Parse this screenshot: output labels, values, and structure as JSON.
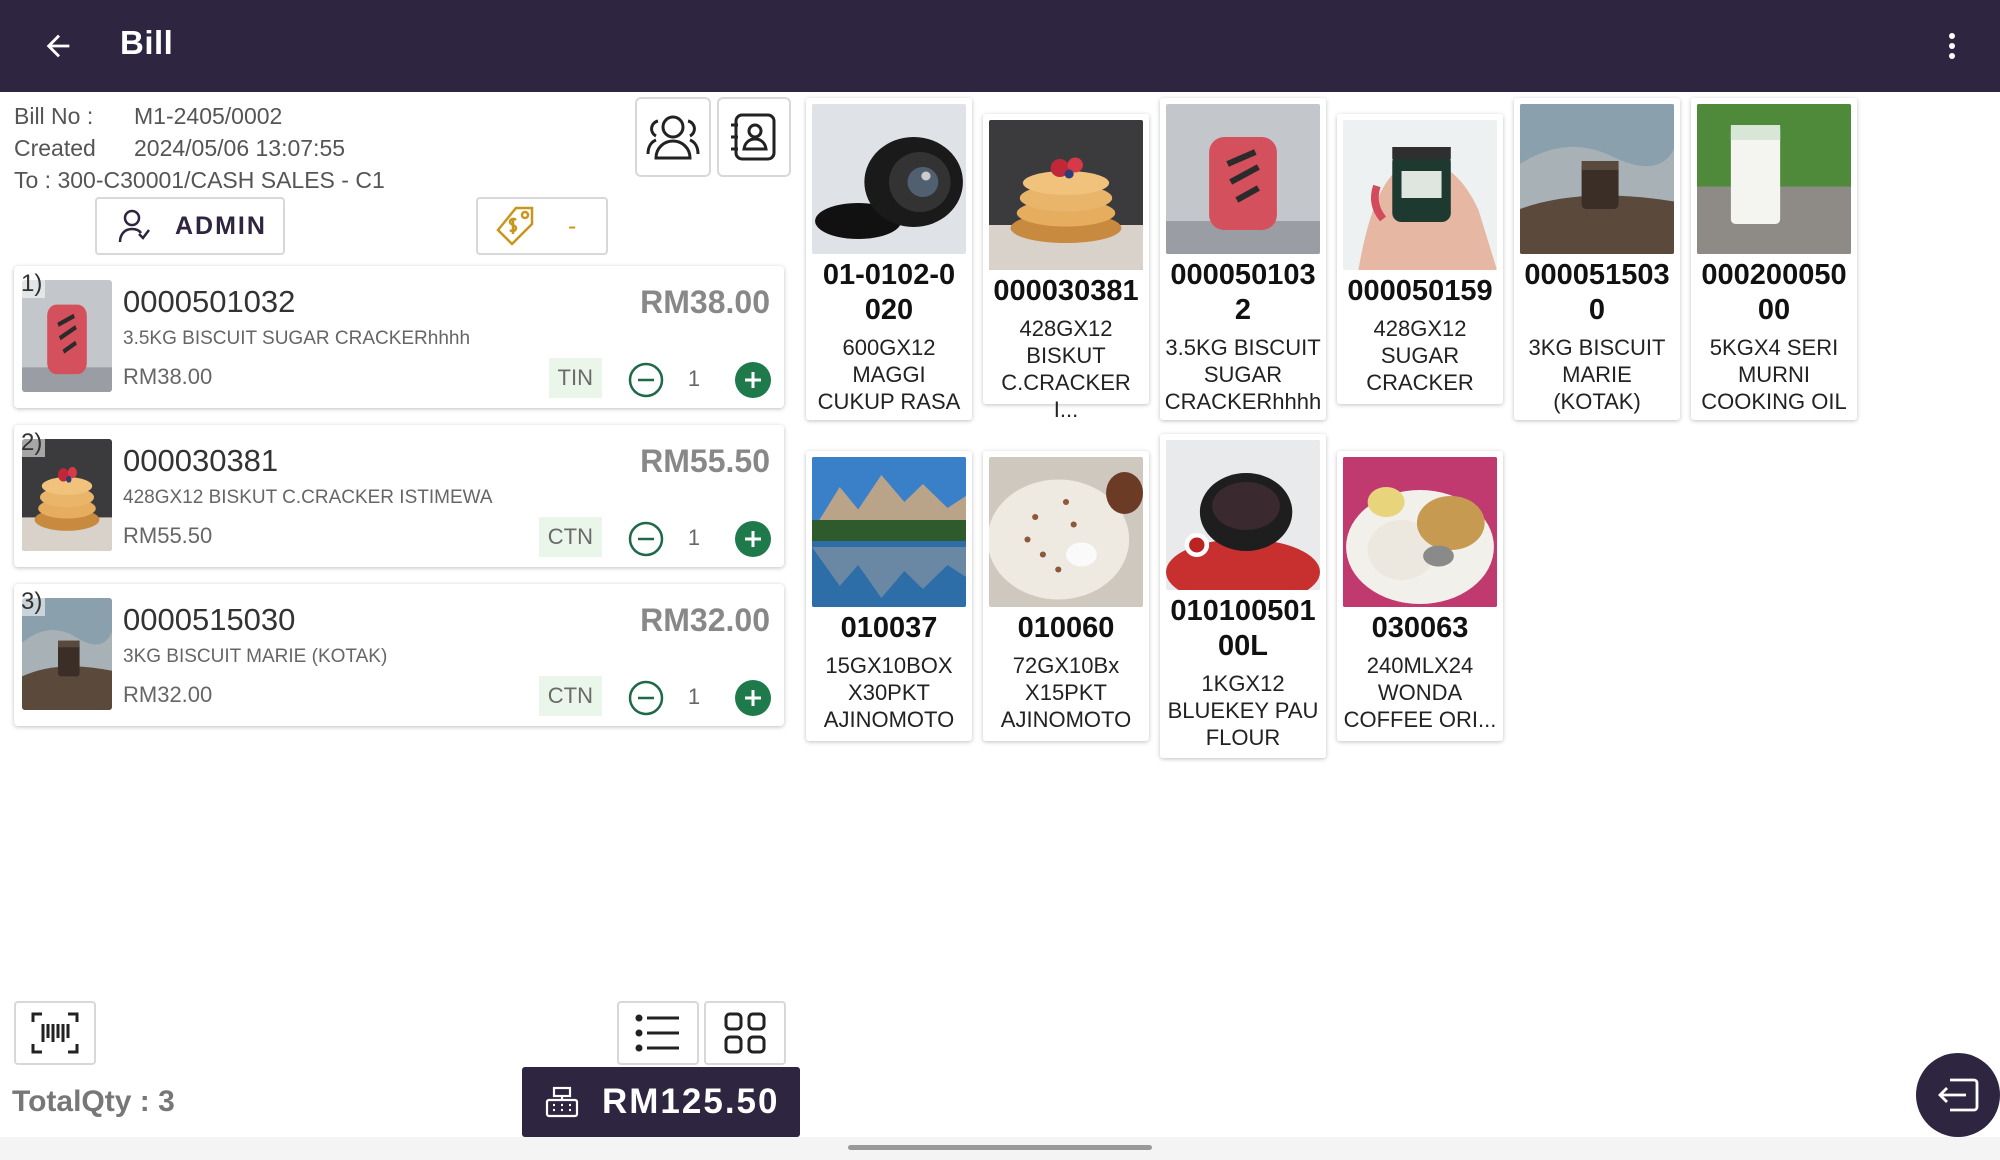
{
  "app_bar": {
    "title": "Bill"
  },
  "bill": {
    "bill_no_label": "Bill No :",
    "bill_no": "M1-2405/0002",
    "created_label": "Created",
    "created": "2024/05/06 13:07:55",
    "to": "To : 300-C30001/CASH SALES - C1",
    "salesperson": "ADMIN",
    "discount": "-"
  },
  "cart": [
    {
      "index": "1)",
      "code": "0000501032",
      "desc": "3.5KG BISCUIT SUGAR CRACKERhhhh",
      "unit_price": "RM38.00",
      "total": "RM38.00",
      "uom": "TIN",
      "qty": "1",
      "image": "red-pouch"
    },
    {
      "index": "2)",
      "code": "000030381",
      "desc": "428GX12 BISKUT C.CRACKER ISTIMEWA",
      "unit_price": "RM55.50",
      "total": "RM55.50",
      "uom": "CTN",
      "qty": "1",
      "image": "pancakes"
    },
    {
      "index": "3)",
      "code": "0000515030",
      "desc": "3KG BISCUIT MARIE (KOTAK)",
      "unit_price": "RM32.00",
      "total": "RM32.00",
      "uom": "CTN",
      "qty": "1",
      "image": "jar-on-rock"
    }
  ],
  "products": [
    {
      "code": "01-0102-0020",
      "code_lines": [
        "01-0102-0",
        "020"
      ],
      "name_lines": [
        "600GX12",
        "MAGGI",
        "CUKUP RASA"
      ],
      "image": "camera-lens"
    },
    {
      "code": "000030381",
      "code_lines": [
        "000030381"
      ],
      "name_lines": [
        "428GX12",
        "BISKUT",
        "C.CRACKER I..."
      ],
      "image": "pancakes"
    },
    {
      "code": "0000501032",
      "code_lines": [
        "000050103",
        "2"
      ],
      "name_lines": [
        "3.5KG BISCUIT",
        "SUGAR",
        "CRACKERhhhh"
      ],
      "image": "red-pouch"
    },
    {
      "code": "000050159",
      "code_lines": [
        "000050159"
      ],
      "name_lines": [
        "428GX12",
        "SUGAR",
        "CRACKER"
      ],
      "image": "jar-in-hand"
    },
    {
      "code": "0000515030",
      "code_lines": [
        "000051503",
        "0"
      ],
      "name_lines": [
        "3KG BISCUIT",
        "MARIE",
        "(KOTAK)"
      ],
      "image": "jar-on-rock"
    },
    {
      "code": "00020005000",
      "code_lines": [
        "000200050",
        "00"
      ],
      "name_lines": [
        "5KGX4 SERI",
        "MURNI",
        "COOKING OIL"
      ],
      "image": "milk-glass"
    },
    {
      "code": "010037",
      "code_lines": [
        "010037"
      ],
      "name_lines": [
        "15GX10BOX",
        "X30PKT",
        "AJINOMOTO"
      ],
      "image": "mountain-lake"
    },
    {
      "code": "010060",
      "code_lines": [
        "010060"
      ],
      "name_lines": [
        "72GX10Bx",
        "X15PKT",
        "AJINOMOTO"
      ],
      "image": "rice-dish"
    },
    {
      "code": "01010050100L",
      "code_lines": [
        "010100501",
        "00L"
      ],
      "name_lines": [
        "1KGX12",
        "BLUEKEY PAU",
        "FLOUR"
      ],
      "image": "bowl-on-tray"
    },
    {
      "code": "030063",
      "code_lines": [
        "030063"
      ],
      "name_lines": [
        "240MLX24",
        "WONDA",
        "COFFEE ORI..."
      ],
      "image": "rice-plate"
    }
  ],
  "footer": {
    "total_qty": "TotalQty : 3",
    "total_amount": "RM125.50"
  },
  "colors": {
    "primary": "#2e2540",
    "plus_green": "#1e7a4a",
    "uom_bg": "#e9f6e9",
    "discount_gold": "#c9951a"
  },
  "icons": [
    "back-arrow-icon",
    "more-vert-icon",
    "customers-icon",
    "contact-card-icon",
    "person-icon",
    "price-tag-icon",
    "minus-circle-icon",
    "plus-circle-icon",
    "barcode-scan-icon",
    "list-view-icon",
    "grid-view-icon",
    "cash-register-icon",
    "exit-icon"
  ]
}
